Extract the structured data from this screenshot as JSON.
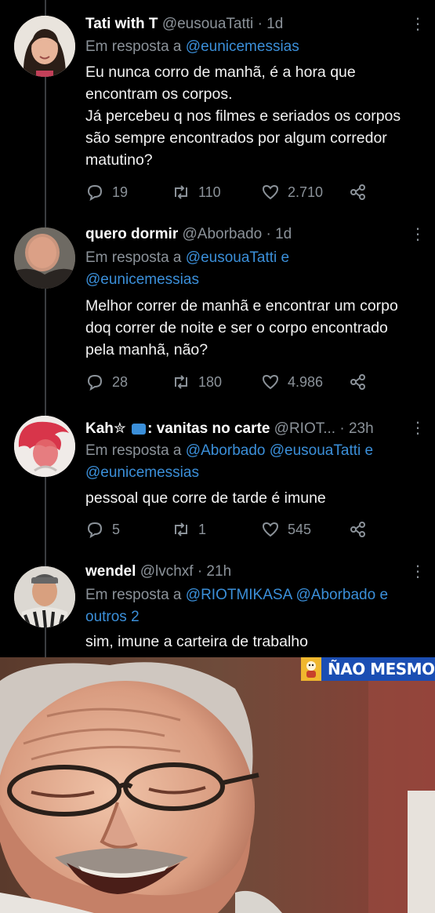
{
  "tweets": [
    {
      "name": "Tati with T",
      "handle": "@eusouaTatti",
      "time": "· 1d",
      "reply_prefix": "Em resposta a",
      "mentions": "@eunicemessias",
      "text": "Eu nunca corro de manhã, é a hora que\nencontram os corpos.\nJá percebeu q nos filmes e seriados os corpos\nsão sempre encontrados por algum corredor\nmatutino?",
      "replies": "19",
      "retweets": "110",
      "likes": "2.710"
    },
    {
      "name": "quero dormir",
      "handle": "@Aborbado",
      "time": "· 1d",
      "reply_prefix": "Em resposta a",
      "mentions_line1": "@eusouaTatti e",
      "mentions_line2": "@eunicemessias",
      "text": "Melhor correr de manhã e encontrar um corpo\ndoq correr de noite e ser o corpo encontrado\npela manhã, não?",
      "replies": "28",
      "retweets": "180",
      "likes": "4.986"
    },
    {
      "name": "Kah✮",
      "name_suffix": ": vanitas no carte",
      "handle": "@RIOT...",
      "time": "· 23h",
      "reply_prefix": "Em resposta a",
      "mentions_line1": "@Aborbado @eusouaTatti e",
      "mentions_line2": "@eunicemessias",
      "text": "pessoal que corre de tarde é imune",
      "replies": "5",
      "retweets": "1",
      "likes": "545"
    },
    {
      "name": "wendel",
      "handle": "@lvchxf",
      "time": "· 21h",
      "reply_prefix": "Em resposta a",
      "mentions_line1": "@RIOTMIKASA @Aborbado e",
      "mentions_line2": "outros 2",
      "text": "sim, imune a carteira de trabalho"
    }
  ],
  "badge": {
    "text": "ÑAO MESMO"
  },
  "icons": [
    "reply-icon",
    "retweet-icon",
    "like-icon",
    "share-icon",
    "more-icon"
  ],
  "colors": {
    "background": "#000000",
    "link": "#3b8fd9",
    "muted": "#8b9299",
    "badge": "#1b4eb3"
  }
}
